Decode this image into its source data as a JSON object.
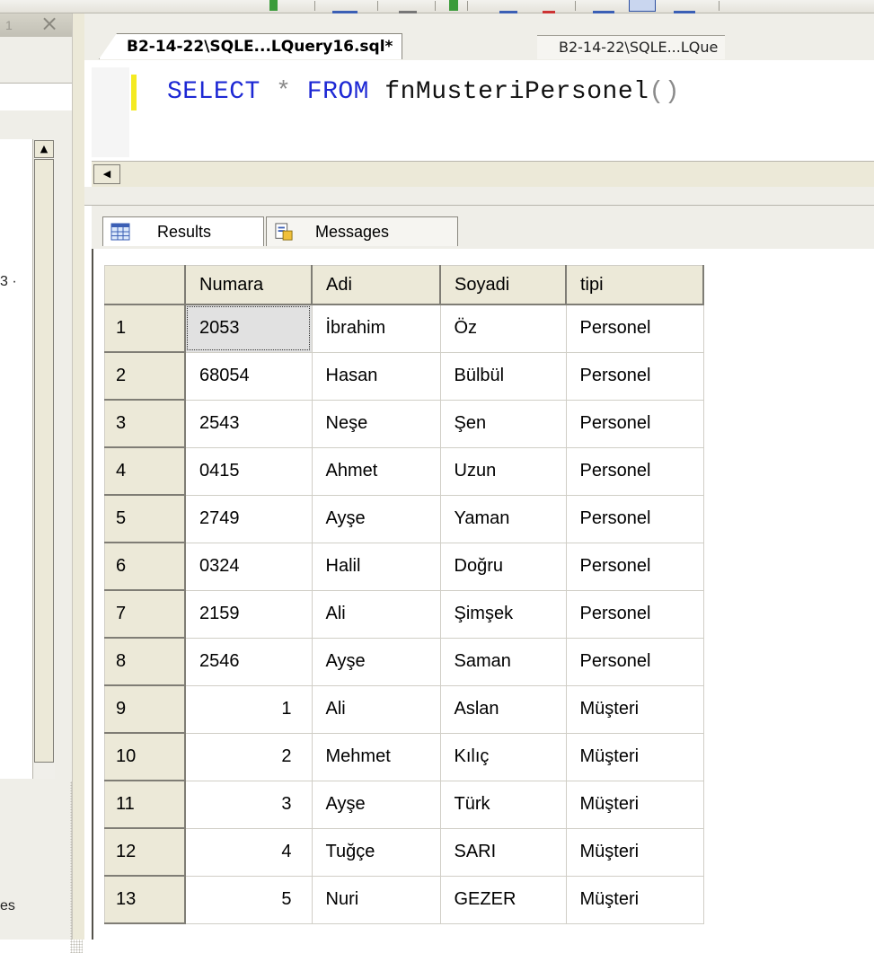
{
  "window": {
    "left_pane": {
      "number_fragment": "1",
      "tree_text_fragment_top": "3 ·",
      "tree_text_fragment_bottom": "es"
    }
  },
  "query_tabs": {
    "active_label": "B2-14-22\\SQLE...LQuery16.sql*",
    "inactive_label": "B2-14-22\\SQLE...LQue"
  },
  "editor": {
    "keyword_select": "SELECT",
    "operator_star": "*",
    "keyword_from": "FROM",
    "function_name": "fnMusteriPersonel",
    "parens": "()"
  },
  "result_tabs": {
    "results_label": "Results",
    "messages_label": "Messages"
  },
  "grid": {
    "columns": [
      "Numara",
      "Adi",
      "Soyadi",
      "tipi"
    ],
    "rows": [
      {
        "n": "1",
        "numara": "2053",
        "adi": "İbrahim",
        "soyadi": "Öz",
        "tipi": "Personel"
      },
      {
        "n": "2",
        "numara": "68054",
        "adi": "Hasan",
        "soyadi": "Bülbül",
        "tipi": "Personel"
      },
      {
        "n": "3",
        "numara": "2543",
        "adi": "Neşe",
        "soyadi": "Şen",
        "tipi": "Personel"
      },
      {
        "n": "4",
        "numara": "0415",
        "adi": "Ahmet",
        "soyadi": "Uzun",
        "tipi": "Personel"
      },
      {
        "n": "5",
        "numara": "2749",
        "adi": "Ayşe",
        "soyadi": "Yaman",
        "tipi": "Personel"
      },
      {
        "n": "6",
        "numara": "0324",
        "adi": "Halil",
        "soyadi": "Doğru",
        "tipi": "Personel"
      },
      {
        "n": "7",
        "numara": "2159",
        "adi": "Ali",
        "soyadi": "Şimşek",
        "tipi": "Personel"
      },
      {
        "n": "8",
        "numara": "2546",
        "adi": "Ayşe",
        "soyadi": "Saman",
        "tipi": "Personel"
      },
      {
        "n": "9",
        "numara": "1",
        "adi": "Ali",
        "soyadi": "Aslan",
        "tipi": "Müşteri"
      },
      {
        "n": "10",
        "numara": "2",
        "adi": "Mehmet",
        "soyadi": "Kılıç",
        "tipi": "Müşteri"
      },
      {
        "n": "11",
        "numara": "3",
        "adi": "Ayşe",
        "soyadi": "Türk",
        "tipi": "Müşteri"
      },
      {
        "n": "12",
        "numara": "4",
        "adi": "Tuğçe",
        "soyadi": "SARI",
        "tipi": "Müşteri"
      },
      {
        "n": "13",
        "numara": "5",
        "adi": "Nuri",
        "soyadi": "GEZER",
        "tipi": "Müşteri"
      }
    ]
  },
  "colors": {
    "keyword": "#1d28d4",
    "change_bar": "#f4ea21",
    "header_bg": "#ece9d8",
    "selected_cell": "#e1e1e1"
  },
  "icons": {
    "results_tab": "grid-icon",
    "messages_tab": "messages-icon",
    "pane_close": "close-icon",
    "scroll_up": "arrow-up-icon",
    "scroll_left": "arrow-left-icon"
  }
}
